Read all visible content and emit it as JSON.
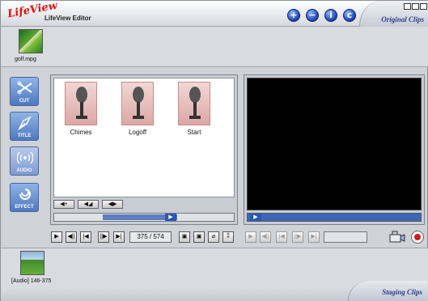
{
  "titlebar": {
    "logo": "LifeView",
    "title": "LifeView Editor",
    "buttons": [
      {
        "icon": "plus-icon",
        "glyph": "+"
      },
      {
        "icon": "minus-icon",
        "glyph": "−"
      },
      {
        "icon": "info-icon",
        "glyph": "i"
      },
      {
        "icon": "copyright-icon",
        "glyph": "c"
      }
    ],
    "original_clips_tab": "Original Clips"
  },
  "original_clips": [
    {
      "label": "golf.mpg"
    }
  ],
  "tools": [
    {
      "label": "CUT",
      "icon": "scissors-icon"
    },
    {
      "label": "TITLE",
      "icon": "pen-icon"
    },
    {
      "label": "AUDIO",
      "icon": "speaker-wave-icon",
      "active": true
    },
    {
      "label": "EFFECT",
      "icon": "swirl-icon"
    }
  ],
  "audio_browser": {
    "items": [
      {
        "name": "Chimes"
      },
      {
        "name": "Logoff"
      },
      {
        "name": "Start"
      }
    ],
    "buttons": [
      "◀+",
      "◀◢",
      "◀▶"
    ]
  },
  "transport": {
    "buttons": [
      "▶",
      "◀||",
      "|◀",
      "||▶",
      "▶|"
    ],
    "counter": "375 / 574",
    "tools": [
      "▣",
      "▣",
      "⌀",
      "⁑"
    ],
    "dim_buttons": [
      "▶",
      "◀||",
      "|◀",
      "||▶",
      "▶|"
    ]
  },
  "staging_clips": [
    {
      "label": "[Audio] 146-375"
    }
  ],
  "staging_tab": "Staging Clips"
}
